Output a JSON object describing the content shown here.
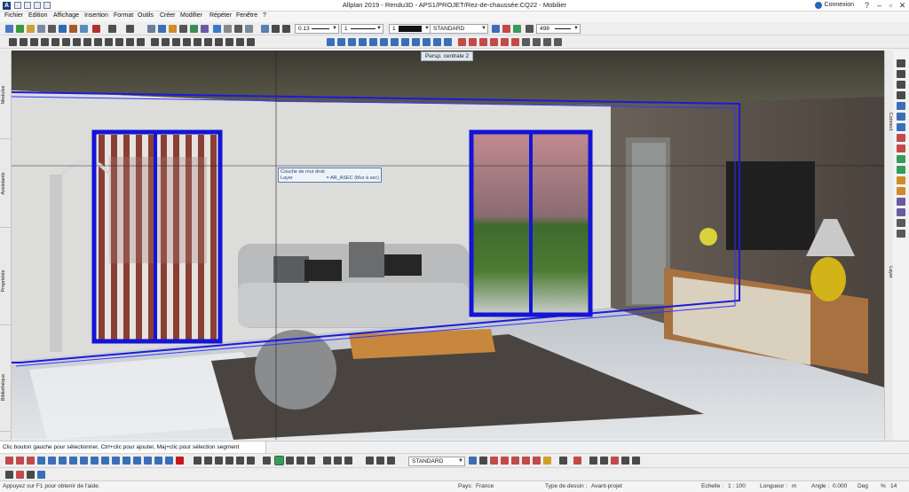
{
  "app": {
    "title": "Allplan 2019 - Rendu3D - APS1/PROJET/Rez-de-chaussée:CQ22 - Mobilier",
    "connexion_label": "Connexion"
  },
  "menu": [
    "Fichier",
    "Edition",
    "Affichage",
    "Insertion",
    "Format",
    "Outils",
    "Créer",
    "Modifier",
    "Répéter",
    "Fenêtre",
    "?"
  ],
  "toolbar": {
    "pen_thickness": "0.13",
    "line_type": "1",
    "color_value": "1",
    "format_style": "STANDARD",
    "pattern_value": "498"
  },
  "viewport": {
    "view_label": "Persp. centrale 2",
    "tooltip": {
      "line1": "Couche de mur droit",
      "layer_label": "Layer",
      "layer_value": "= AR_ASEC (Mur à sec)"
    }
  },
  "left_panel": {
    "tabs": [
      "Modules",
      "Assistants",
      "Propriétés",
      "Bibliothèque"
    ]
  },
  "right_panel": {
    "tabs": [
      "Connect",
      "Layer"
    ]
  },
  "prompt": {
    "text": "Clic bouton gauche pour sélectionner, Ctrl+clic pour ajouter, Maj+clic pour sélection segment"
  },
  "bottom_toolbar": {
    "format_style": "STANDARD"
  },
  "statusbar": {
    "help": "Appuyez sur F1 pour obtenir de l'aide.",
    "pays_label": "Pays:",
    "pays_value": "France",
    "type_label": "Type de dessin :",
    "type_value": "Avant-projet",
    "echelle_label": "Echelle :",
    "echelle_value": "1 : 100",
    "longueur_label": "Longueur :",
    "longueur_value": "m",
    "angle_label": "Angle :",
    "angle_value": "0.000",
    "angle_unit": "Deg",
    "percent_label": "%",
    "percent_value": "14"
  },
  "colors": {
    "selection_blue": "#1a1ae0",
    "titlebar_bg": "#ffffff",
    "toolbar_bg": "#eeeeee"
  }
}
